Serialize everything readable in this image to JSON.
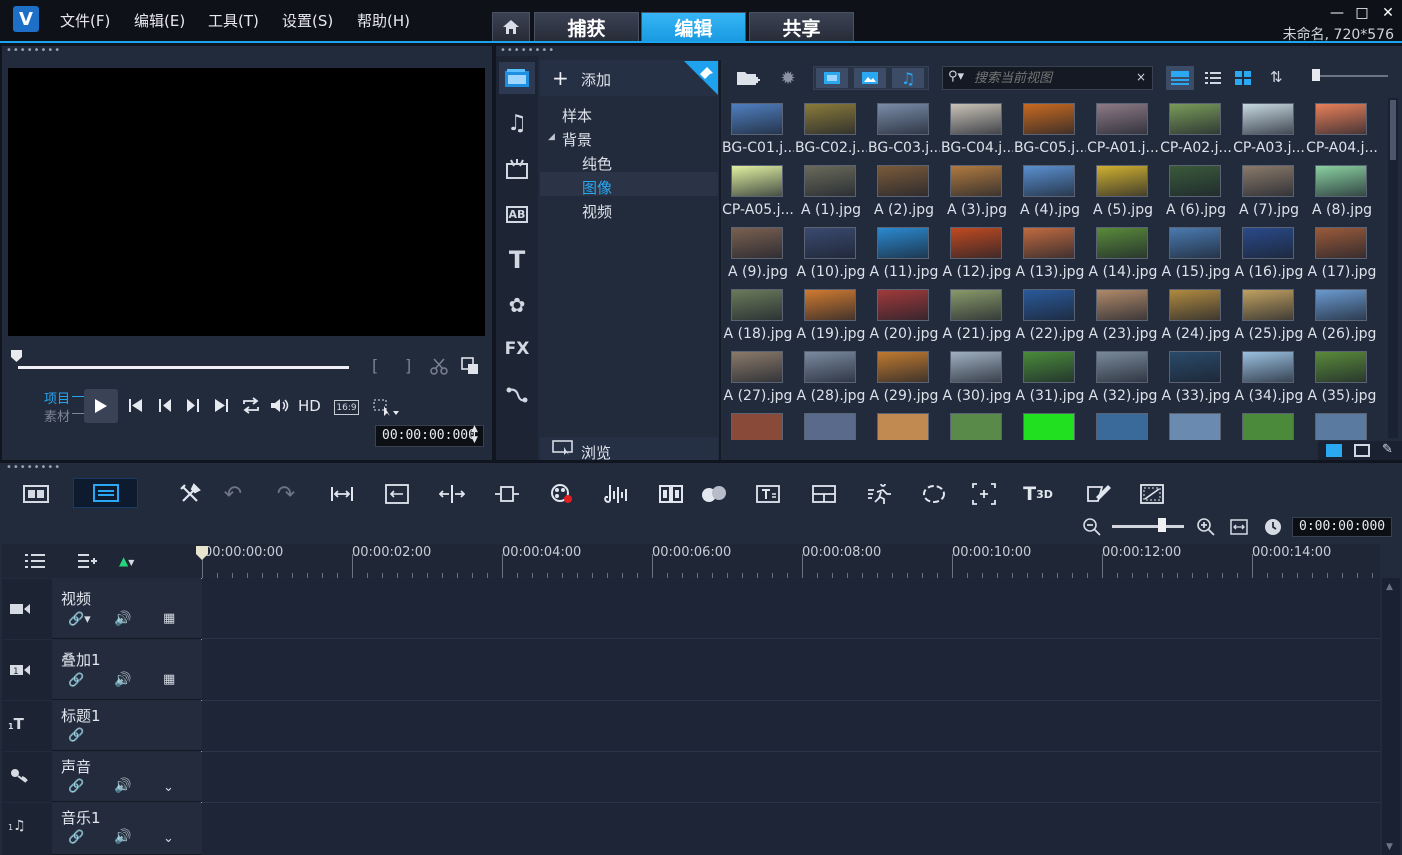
{
  "app": {
    "window_title": "未命名, 720*576",
    "menu": [
      "文件(F)",
      "编辑(E)",
      "工具(T)",
      "设置(S)",
      "帮助(H)"
    ],
    "tabs": [
      "捕获",
      "编辑",
      "共享"
    ],
    "active_tab": "编辑"
  },
  "preview": {
    "project_label": "项目",
    "clip_label": "素材",
    "hd_label": "HD",
    "aspect": "16:9",
    "timecode": "00:00:00:000",
    "bracket_in": "[",
    "bracket_out": "]"
  },
  "library": {
    "add_label": "添加",
    "search_placeholder": "搜索当前视图",
    "browse_label": "浏览",
    "tree": {
      "sample": "样本",
      "background": "背景",
      "solid": "纯色",
      "image": "图像",
      "video": "视频"
    },
    "thumbs": [
      "BG-C01.j...",
      "BG-C02.j...",
      "BG-C03.j...",
      "BG-C04.j...",
      "BG-C05.j...",
      "CP-A01.j...",
      "CP-A02.j...",
      "CP-A03.j...",
      "CP-A04.j...",
      "CP-A05.j...",
      "A (1).jpg",
      "A (2).jpg",
      "A (3).jpg",
      "A (4).jpg",
      "A (5).jpg",
      "A (6).jpg",
      "A (7).jpg",
      "A (8).jpg",
      "A (9).jpg",
      "A (10).jpg",
      "A (11).jpg",
      "A (12).jpg",
      "A (13).jpg",
      "A (14).jpg",
      "A (15).jpg",
      "A (16).jpg",
      "A (17).jpg",
      "A (18).jpg",
      "A (19).jpg",
      "A (20).jpg",
      "A (21).jpg",
      "A (22).jpg",
      "A (23).jpg",
      "A (24).jpg",
      "A (25).jpg",
      "A (26).jpg",
      "A (27).jpg",
      "A (28).jpg",
      "A (29).jpg",
      "A (30).jpg",
      "A (31).jpg",
      "A (32).jpg",
      "A (33).jpg",
      "A (34).jpg",
      "A (35).jpg"
    ],
    "thumb_colors": [
      "#4f7fc0",
      "#8a7a3a",
      "#7a8ca8",
      "#c9c3b7",
      "#c86a20",
      "#8d7a85",
      "#7a9a5a",
      "#c7d8e0",
      "#e8805a",
      "#e0f0a0",
      "#6a6a5a",
      "#7a5a3a",
      "#b07a40",
      "#5a90d0",
      "#d0b030",
      "#3a5a3a",
      "#8a7a6a",
      "#8ad0a0",
      "#7a6050",
      "#3a4a70",
      "#2a8ad0",
      "#c04a20",
      "#c06a40",
      "#5a8a3a",
      "#4a7ab0",
      "#2a4a8a",
      "#9a5a3a",
      "#6a7a5a",
      "#d07a30",
      "#a03a3a",
      "#8a9a6a",
      "#2a5a9a",
      "#b08a6a",
      "#b08a40",
      "#c0a060",
      "#6a9ad0",
      "#8a7a6a",
      "#7a8aa0",
      "#c07a30",
      "#a0b0c0",
      "#4a8a3a",
      "#7a8a9a",
      "#2a4a6a",
      "#9ac0e0",
      "#5a8a3a"
    ],
    "partial_colors": [
      "#8a4a3a",
      "#5a6a8a",
      "#c08a50",
      "#5a8a4a",
      "#20e020",
      "#3a6a9a",
      "#6a8ab0",
      "#4a8a3a",
      "#5a7aa0"
    ]
  },
  "timeline": {
    "timecode": "0:00:00:000",
    "ruler": [
      "00:00:00:00",
      "00:00:02:00",
      "00:00:04:00",
      "00:00:06:00",
      "00:00:08:00",
      "00:00:10:00",
      "00:00:12:00",
      "00:00:14:00"
    ],
    "tracks": [
      "视频",
      "叠加1",
      "标题1",
      "声音",
      "音乐1"
    ],
    "title_3d": "T3D"
  }
}
